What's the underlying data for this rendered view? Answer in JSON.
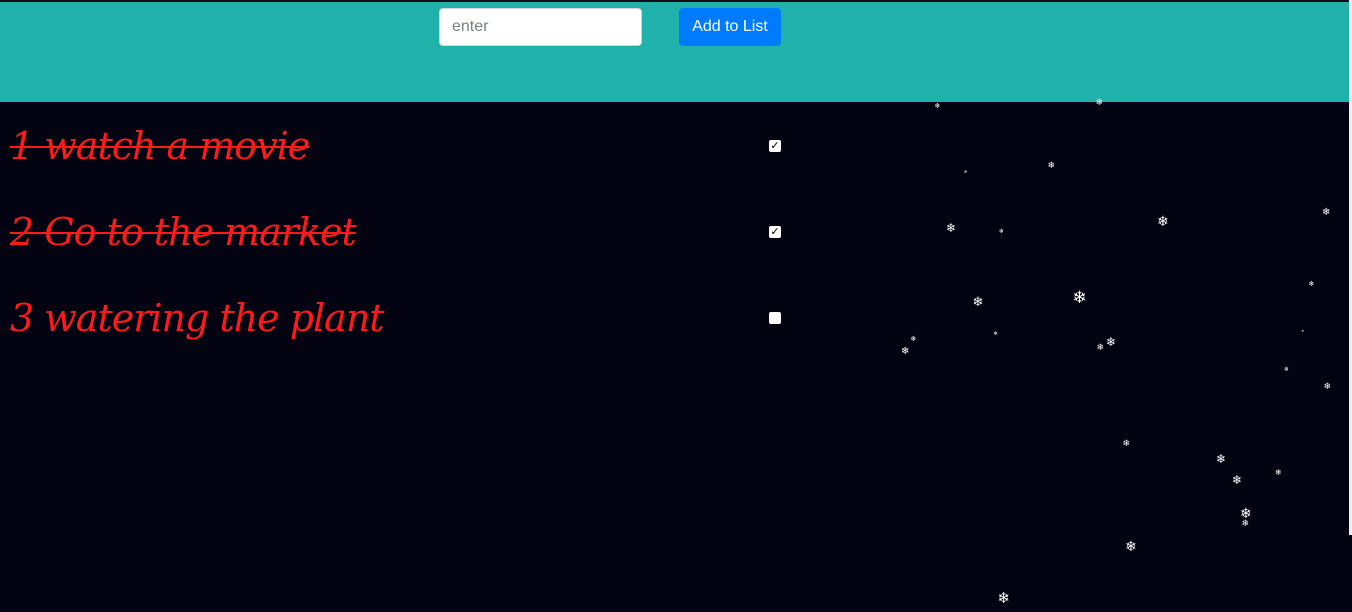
{
  "header": {
    "input_value": "",
    "input_placeholder": "enter",
    "add_button_label": "Add to List",
    "background_color": "#20b2aa"
  },
  "todos": [
    {
      "text": "1 watch a movie",
      "checked": true
    },
    {
      "text": "2 Go to the market",
      "checked": true
    },
    {
      "text": "3 watering the plant",
      "checked": false
    }
  ],
  "colors": {
    "page_background": "#030312",
    "todo_text": "#ff1a1a",
    "button": "#007bff",
    "snowflake": "#ffffff"
  },
  "decoration": {
    "snowflake_icon": "snowflake-icon"
  }
}
